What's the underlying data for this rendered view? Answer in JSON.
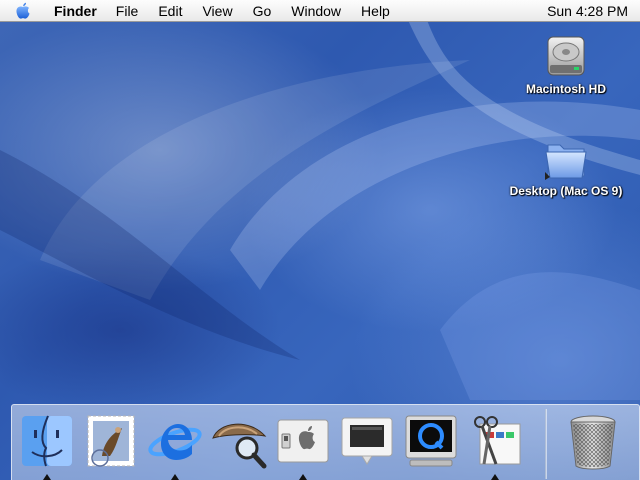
{
  "menubar": {
    "apple_icon": "apple-logo-icon",
    "app_name": "Finder",
    "items": [
      "File",
      "Edit",
      "View",
      "Go",
      "Window",
      "Help"
    ],
    "clock": "Sun 4:28 PM"
  },
  "desktop": {
    "icons": [
      {
        "label": "Macintosh HD",
        "icon": "hard-drive-icon"
      },
      {
        "label": "Desktop (Mac OS 9)",
        "icon": "folder-icon"
      }
    ]
  },
  "dock": {
    "items": [
      {
        "icon": "finder-icon",
        "running": true
      },
      {
        "icon": "mail-icon",
        "running": false
      },
      {
        "icon": "internet-explorer-icon",
        "running": true
      },
      {
        "icon": "sherlock-icon",
        "running": false
      },
      {
        "icon": "system-preferences-icon",
        "running": true
      },
      {
        "icon": "monitor-preview-icon",
        "running": false
      },
      {
        "icon": "quicktime-icon",
        "running": false
      },
      {
        "icon": "clipping-scissors-icon",
        "running": true
      },
      {
        "icon": "trash-icon",
        "running": false
      }
    ]
  },
  "colors": {
    "wallpaper": "#2f5aa8",
    "menubar": "#efefef",
    "dock_indicator": "#111111"
  }
}
